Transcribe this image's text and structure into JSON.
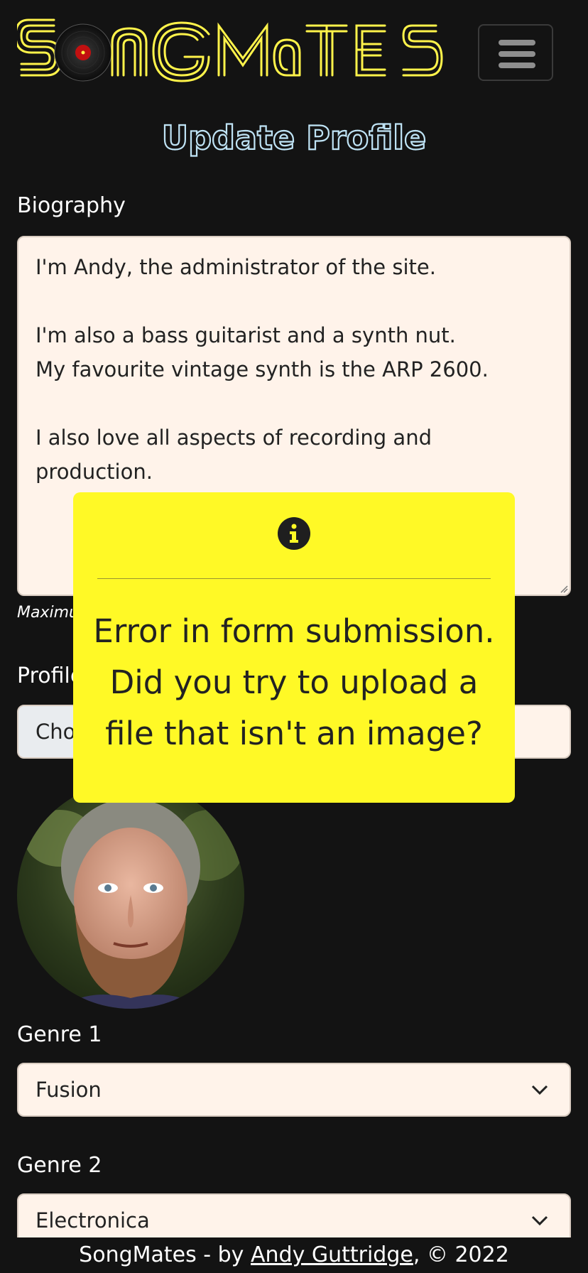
{
  "brand": {
    "name": "SongMates",
    "logo_text": "SongMates"
  },
  "navbar": {
    "toggle_icon": "hamburger-menu-icon"
  },
  "page_title": "Update Profile",
  "biography": {
    "label": "Biography",
    "value": "I'm Andy, the administrator of the site.\n\nI'm also a bass guitarist and a synth nut.\nMy favourite vintage synth is the ARP 2600.\n\nI also love all aspects of recording and production.",
    "hint": "Maximu"
  },
  "profile_image": {
    "label": "Profile",
    "choose_button": "Cho"
  },
  "genre1": {
    "label": "Genre 1",
    "selected": "Fusion"
  },
  "genre2": {
    "label": "Genre 2",
    "selected": "Electronica"
  },
  "modal": {
    "icon": "info-circle-icon",
    "message": "Error in form submission. Did you try to upload a file that isn't an image?"
  },
  "footer": {
    "prefix": "SongMates - by ",
    "author": "Andy Guttridge",
    "suffix": ", © 2022"
  },
  "colors": {
    "background": "#131313",
    "logo_yellow": "#fff34a",
    "title_blue": "#bfe3f5",
    "modal_yellow": "#fff926",
    "field_bg": "#fff3ea"
  }
}
